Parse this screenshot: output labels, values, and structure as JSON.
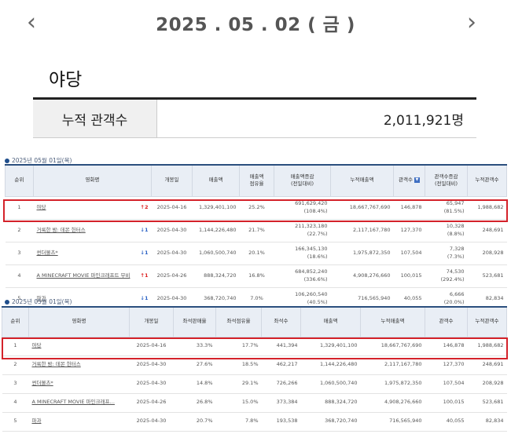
{
  "header": {
    "prev_arrow": "‹",
    "next_arrow": "›",
    "date": "2025 . 05 . 02 ( 금 )"
  },
  "movie": {
    "title": "야당",
    "audience_label": "누적 관객수",
    "audience_value": "2,011,921명"
  },
  "section1": {
    "title": "2025년 05월 01일(목)",
    "headers": [
      "순위",
      "영화명",
      "개봉일",
      "매출액",
      "매출액\n점유율",
      "매출액증감\n(전일대비)",
      "누적매출액",
      "관객수",
      "관객수증감\n(전일대비)",
      "누적관객수"
    ],
    "rows": [
      {
        "rank": "1",
        "title": "야당",
        "change": "↑2",
        "dir": "up",
        "open": "2025-04-16",
        "sales": "1,329,401,100",
        "share": "25.2%",
        "delta1": "691,629,420",
        "delta2": "(108.4%)",
        "cum_sales": "18,667,767,690",
        "aud": "146,878",
        "adelta1": "65,947",
        "adelta2": "(81.5%)",
        "cum_aud": "1,988,682"
      },
      {
        "rank": "2",
        "title": "거룩한 밤: 데몬 헌터스",
        "change": "↓1",
        "dir": "down",
        "open": "2025-04-30",
        "sales": "1,144,226,480",
        "share": "21.7%",
        "delta1": "211,323,180",
        "delta2": "(22.7%)",
        "cum_sales": "2,117,167,780",
        "aud": "127,370",
        "adelta1": "10,328",
        "adelta2": "(8.8%)",
        "cum_aud": "248,691"
      },
      {
        "rank": "3",
        "title": "썬더볼츠*",
        "change": "↓1",
        "dir": "down",
        "open": "2025-04-30",
        "sales": "1,060,500,740",
        "share": "20.1%",
        "delta1": "166,345,130",
        "delta2": "(18.6%)",
        "cum_sales": "1,975,872,350",
        "aud": "107,504",
        "adelta1": "7,328",
        "adelta2": "(7.3%)",
        "cum_aud": "208,928"
      },
      {
        "rank": "4",
        "title": "A MINECRAFT MOVIE 마인크래프트 무비",
        "change": "↑1",
        "dir": "up",
        "open": "2025-04-26",
        "sales": "888,324,720",
        "share": "16.8%",
        "delta1": "684,852,240",
        "delta2": "(336.6%)",
        "cum_sales": "4,908,276,660",
        "aud": "100,015",
        "adelta1": "74,530",
        "adelta2": "(292.4%)",
        "cum_aud": "523,681"
      },
      {
        "rank": "5",
        "title": "파과",
        "change": "↓1",
        "dir": "down",
        "open": "2025-04-30",
        "sales": "368,720,740",
        "share": "7.0%",
        "delta1": "106,260,540",
        "delta2": "(40.5%)",
        "cum_sales": "716,565,940",
        "aud": "40,055",
        "adelta1": "6,666",
        "adelta2": "(20.0%)",
        "cum_aud": "82,834"
      }
    ]
  },
  "section2": {
    "title": "2025년 05월 01일(목)",
    "headers": [
      "순위",
      "영화명",
      "개봉일",
      "좌석판매율",
      "좌석점유율",
      "좌석수",
      "매출액",
      "누적매출액",
      "관객수",
      "누적관객수"
    ],
    "rows": [
      {
        "rank": "1",
        "title": "야당",
        "open": "2025-04-16",
        "sale_rate": "33.3%",
        "seat_share": "17.7%",
        "seats": "441,394",
        "sales": "1,329,401,100",
        "cum_sales": "18,667,767,690",
        "aud": "146,878",
        "cum_aud": "1,988,682"
      },
      {
        "rank": "2",
        "title": "거룩한 밤: 데몬 헌터스",
        "open": "2025-04-30",
        "sale_rate": "27.6%",
        "seat_share": "18.5%",
        "seats": "462,217",
        "sales": "1,144,226,480",
        "cum_sales": "2,117,167,780",
        "aud": "127,370",
        "cum_aud": "248,691"
      },
      {
        "rank": "3",
        "title": "썬더볼츠*",
        "open": "2025-04-30",
        "sale_rate": "14.8%",
        "seat_share": "29.1%",
        "seats": "726,266",
        "sales": "1,060,500,740",
        "cum_sales": "1,975,872,350",
        "aud": "107,504",
        "cum_aud": "208,928"
      },
      {
        "rank": "4",
        "title": "A MINECRAFT MOVIE 마인크래프…",
        "open": "2025-04-26",
        "sale_rate": "26.8%",
        "seat_share": "15.0%",
        "seats": "373,384",
        "sales": "888,324,720",
        "cum_sales": "4,908,276,660",
        "aud": "100,015",
        "cum_aud": "523,681"
      },
      {
        "rank": "5",
        "title": "파과",
        "open": "2025-04-30",
        "sale_rate": "20.7%",
        "seat_share": "7.8%",
        "seats": "193,538",
        "sales": "368,720,740",
        "cum_sales": "716,565,940",
        "aud": "40,055",
        "cum_aud": "82,834"
      }
    ]
  },
  "colors": {
    "highlight": "#d4222a",
    "header_border": "#2b4f7e",
    "rank_up": "#d22222",
    "rank_down": "#2b62c5"
  }
}
